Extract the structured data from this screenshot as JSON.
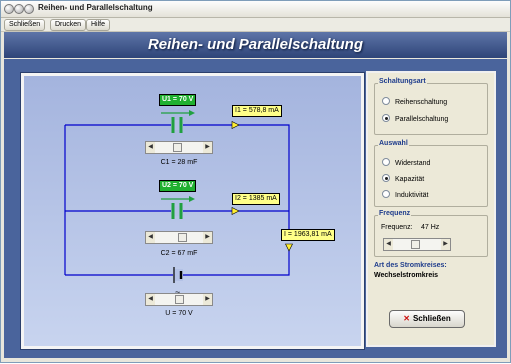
{
  "window": {
    "title": "Reihen- und Parallelschaltung"
  },
  "menu": {
    "items": [
      "Schließen",
      "Drucken",
      "Hilfe"
    ]
  },
  "header": {
    "title": "Reihen- und Parallelschaltung"
  },
  "circuit": {
    "u1_label": "U1 = 70 V",
    "i1_label": "I1 = 578,8 mA",
    "c1_label": "C1 = 28 mF",
    "c1_level": 0.45,
    "u2_label": "U2 = 70 V",
    "i2_label": "I2 = 1385 mA",
    "c2_label": "C2 = 67 mF",
    "c2_level": 0.6,
    "i_total_label": "I = 1963,81 mA",
    "u_label": "U = 70 V",
    "u_level": 0.5,
    "source_symbol": "~"
  },
  "schaltungsart": {
    "title": "Schaltungsart",
    "options": [
      "Reihenschaltung",
      "Parallelschaltung"
    ],
    "selected": "Parallelschaltung"
  },
  "auswahl": {
    "title": "Auswahl",
    "options": [
      "Widerstand",
      "Kapazität",
      "Induktivität"
    ],
    "selected": "Kapazität"
  },
  "frequenz": {
    "title": "Frequenz",
    "label": "Frequenz:",
    "value": "47 Hz",
    "level": 0.45
  },
  "stromkreis": {
    "title": "Art des Stromkreises:",
    "value": "Wechselstromkreis"
  },
  "close_button": {
    "label": "Schließen"
  },
  "colors": {
    "header": "#3a5088",
    "content_bg": "#4a649c",
    "circuit_bg": "#b4c2e6",
    "wire": "#0000cc",
    "capacitor": "#20a040",
    "yellow_label": "#ffff88",
    "green_label": "#20b030"
  }
}
